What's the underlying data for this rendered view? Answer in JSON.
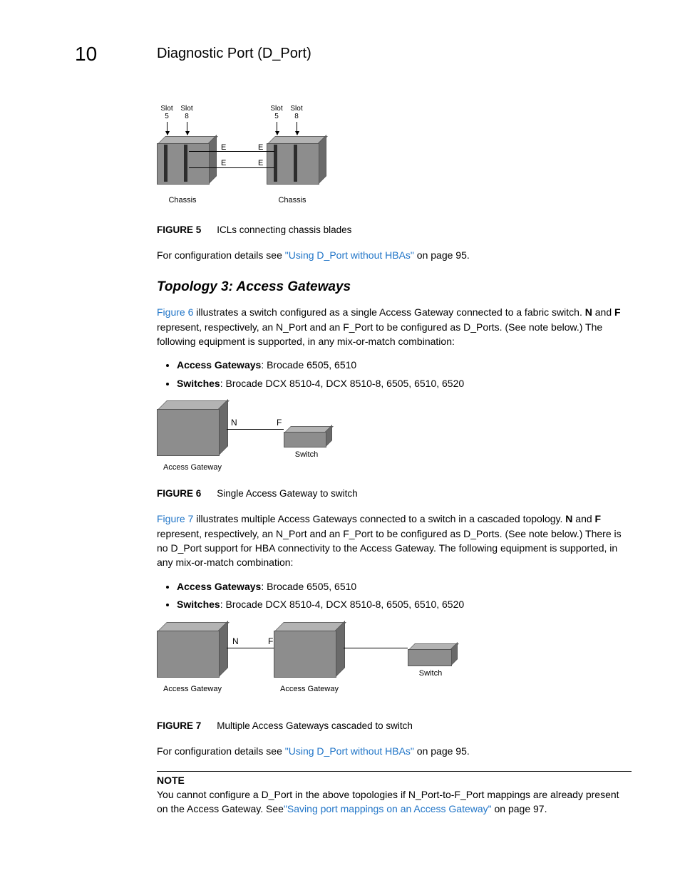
{
  "header": {
    "chapter_number": "10",
    "chapter_title": "Diagnostic Port (D_Port)"
  },
  "fig5": {
    "label": "FIGURE 5",
    "caption": "ICLs connecting chassis blades",
    "slot5": "Slot\n5",
    "slot8": "Slot\n8",
    "e": "E",
    "chassis": "Chassis"
  },
  "para_after_fig5_pre": "For configuration details see ",
  "para_after_fig5_link": "\"Using D_Port without HBAs\"",
  "para_after_fig5_post": " on page 95.",
  "subheading_t3": "Topology 3: Access Gateways",
  "t3_para1_link": "Figure 6",
  "t3_para1_mid": " illustrates a switch configured as a single Access Gateway connected to a fabric switch. ",
  "t3_para1_N": "N",
  "t3_para1_mid2": " and ",
  "t3_para1_F": "F",
  "t3_para1_end": " represent, respectively, an N_Port and an F_Port to be configured as D_Ports. (See note below.) The following equipment is supported, in any mix-or-match combination:",
  "bullets_t3_a": [
    {
      "bold": "Access Gateways",
      "rest": ": Brocade 6505, 6510"
    },
    {
      "bold": "Switches",
      "rest": ": Brocade DCX 8510-4, DCX 8510-8, 6505, 6510, 6520"
    }
  ],
  "fig6": {
    "label": "FIGURE 6",
    "caption": "Single Access Gateway to switch",
    "N": "N",
    "F": "F",
    "ag": "Access Gateway",
    "sw": "Switch"
  },
  "t3_para2_link": "Figure 7",
  "t3_para2_mid": " illustrates multiple Access Gateways connected to a switch in a cascaded topology. ",
  "t3_para2_N": "N",
  "t3_para2_mid2": " and ",
  "t3_para2_F": "F",
  "t3_para2_end": " represent, respectively, an N_Port and an F_Port to be configured as D_Ports. (See note below.) There is no D_Port support for HBA connectivity to the Access Gateway. The following equipment is supported, in any mix-or-match combination:",
  "bullets_t3_b": [
    {
      "bold": "Access Gateways",
      "rest": ": Brocade 6505, 6510"
    },
    {
      "bold": "Switches",
      "rest": ": Brocade DCX 8510-4, DCX 8510-8, 6505, 6510, 6520"
    }
  ],
  "fig7": {
    "label": "FIGURE 7",
    "caption": "Multiple Access Gateways cascaded to switch",
    "N": "N",
    "F": "F",
    "ag": "Access Gateway",
    "sw": "Switch"
  },
  "para_after_fig7_pre": "For configuration details see ",
  "para_after_fig7_link": "\"Using D_Port without HBAs\"",
  "para_after_fig7_post": " on page 95.",
  "note": {
    "label": "NOTE",
    "body_pre": "You cannot configure a D_Port in the above topologies if N_Port-to-F_Port mappings are already present on the Access Gateway. See",
    "body_link": "\"Saving port mappings on an Access Gateway\"",
    "body_post": " on page 97."
  }
}
